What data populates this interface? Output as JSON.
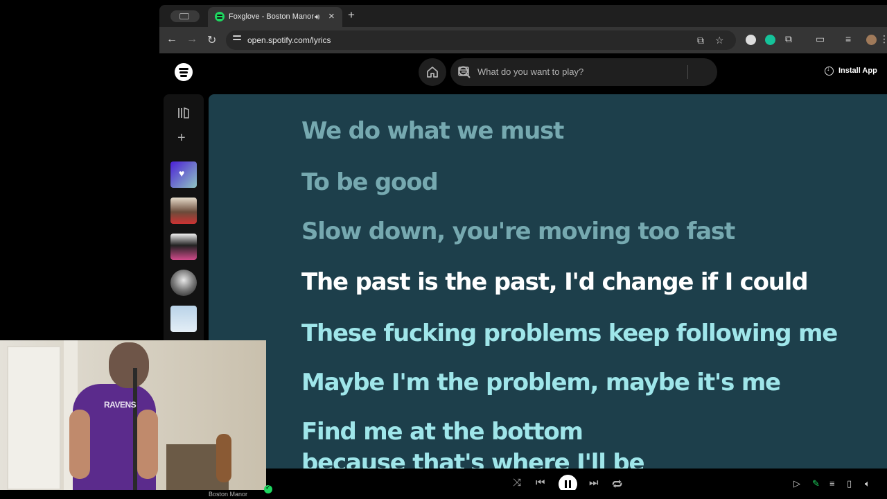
{
  "browser": {
    "tab": {
      "title": "Foxglove - Boston Manor"
    },
    "newtab_icon": "plus-icon",
    "url": "open.spotify.com/lyrics"
  },
  "spotify": {
    "search_placeholder": "What do you want to play?",
    "install_label": "Install App",
    "accent": "#1ed760",
    "lyrics_bg": "#1d3f4b",
    "lyrics": [
      {
        "text": "We do what we must",
        "state": "past"
      },
      {
        "text": "To be good",
        "state": "past"
      },
      {
        "text": "Slow down, you're moving too fast",
        "state": "past"
      },
      {
        "text": "The past is the past, I'd change if I could",
        "state": "current"
      },
      {
        "text": "These fucking problems keep following me",
        "state": "future"
      },
      {
        "text": "Maybe I'm the problem, maybe it's me",
        "state": "future"
      },
      {
        "text": "Find me at the bottom",
        "state": "future"
      },
      {
        "text": "because that's where I'll be",
        "state": "future"
      }
    ]
  },
  "player": {
    "artist": "Boston Manor",
    "playing": true
  },
  "webcam": {
    "shirt_text": "RAVENS"
  }
}
